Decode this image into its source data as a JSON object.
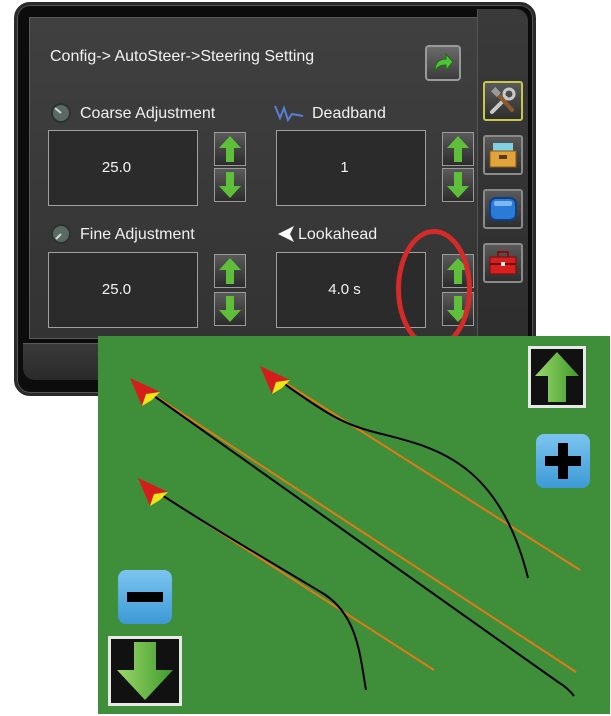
{
  "screen": {
    "title": "Config-> AutoSteer->Steering Setting",
    "back_icon": "back-arrow-icon"
  },
  "settings": [
    {
      "key": "coarse",
      "label": "Coarse Adjustment",
      "value": "25.0",
      "icon": "dial-coarse-icon"
    },
    {
      "key": "deadband",
      "label": "Deadband",
      "value": "1",
      "icon": "waveform-icon"
    },
    {
      "key": "fine",
      "label": "Fine Adjustment",
      "value": "25.0",
      "icon": "dial-fine-icon"
    },
    {
      "key": "lookahead",
      "label": "Lookahead",
      "value": "4.0 s",
      "icon": "lookahead-pointer-icon"
    }
  ],
  "side_tabs": [
    {
      "name": "tools-tab",
      "icon": "tools-icon",
      "active": true
    },
    {
      "name": "data-tab",
      "icon": "file-box-icon",
      "active": false
    },
    {
      "name": "display-tab",
      "icon": "screen-icon",
      "active": false
    },
    {
      "name": "toolbox-tab",
      "icon": "toolbox-icon",
      "active": false
    }
  ],
  "guidance_view": {
    "up_icon": "up-arrow-icon",
    "plus_icon": "plus-icon",
    "minus_icon": "minus-icon",
    "down_icon": "down-arrow-icon"
  },
  "colors": {
    "console_bg": "#404040",
    "guidance_bg": "#3e8e3a",
    "arrow_green": "#5fbf3a",
    "guideline_orange": "#e07a16",
    "highlight_red": "#d42a2a",
    "sign_blue": "#4aa6de"
  }
}
